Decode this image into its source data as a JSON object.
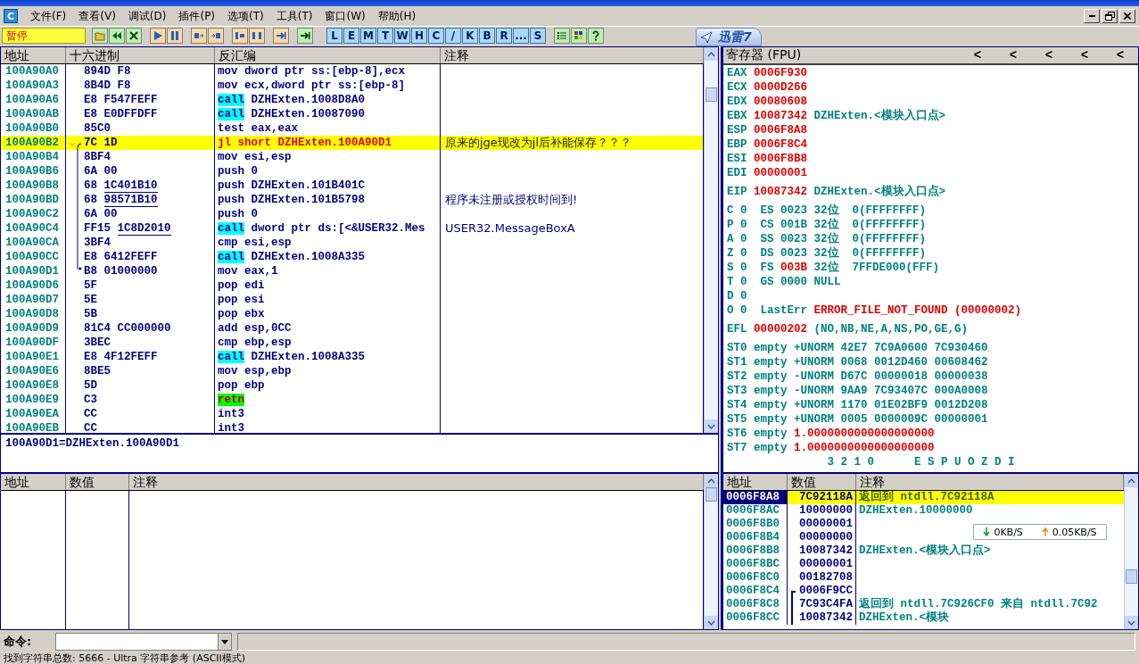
{
  "app_icon": "C",
  "menu": [
    "文件(F)",
    "查看(V)",
    "调试(D)",
    "插件(P)",
    "选项(T)",
    "工具(T)",
    "窗口(W)",
    "帮助(H)"
  ],
  "toolbar": {
    "status": "暂停",
    "letter_buttons": [
      "L",
      "E",
      "M",
      "T",
      "W",
      "H",
      "C",
      "/",
      "K",
      "B",
      "R",
      "...",
      "S"
    ]
  },
  "disassembly": {
    "columns": [
      "地址",
      "十六进制",
      "反汇编",
      "注释"
    ],
    "rows": [
      {
        "address": "100A90A0",
        "hex": "894D F8",
        "disasm": "mov dword ptr ss:[ebp-8],ecx",
        "kind": "plain",
        "selected": false
      },
      {
        "address": "100A90A3",
        "hex": "8B4D F8",
        "disasm": "mov ecx,dword ptr ss:[ebp-8]",
        "kind": "plain",
        "selected": false
      },
      {
        "address": "100A90A6",
        "hex": "E8 F547FEFF",
        "mnemonic": "call",
        "disasm": "DZHExten.1008D8A0",
        "kind": "call",
        "selected": false
      },
      {
        "address": "100A90AB",
        "hex": "E8 E0DFFDFF",
        "mnemonic": "call",
        "disasm": "DZHExten.10087090",
        "kind": "call",
        "selected": false
      },
      {
        "address": "100A90B0",
        "hex": "85C0",
        "disasm": "test eax,eax",
        "kind": "plain",
        "selected": false
      },
      {
        "address": "100A90B2",
        "hex": "7C 1D",
        "disasm": "jl short DZHExten.100A90D1",
        "kind": "jump",
        "selected": true,
        "jump_source": true,
        "comment": "原来的jge现改为jl后补能保存？？？"
      },
      {
        "address": "100A90B4",
        "hex": "8BF4",
        "disasm": "mov esi,esp",
        "kind": "plain",
        "selected": false
      },
      {
        "address": "100A90B6",
        "hex": "6A 00",
        "disasm": "push 0",
        "kind": "plain",
        "selected": false
      },
      {
        "address": "100A90B8",
        "hex": "68",
        "hex_fixup": "1C401B10",
        "disasm": "push DZHExten.101B401C",
        "kind": "plain",
        "selected": false
      },
      {
        "address": "100A90BD",
        "hex": "68",
        "hex_fixup": "98571B10",
        "disasm": "push DZHExten.101B5798",
        "kind": "plain",
        "selected": false,
        "comment": "程序未注册或授权时间到!"
      },
      {
        "address": "100A90C2",
        "hex": "6A 00",
        "disasm": "push 0",
        "kind": "plain",
        "selected": false
      },
      {
        "address": "100A90C4",
        "hex": "FF15",
        "hex_fixup": "1C8D2010",
        "mnemonic": "call",
        "disasm": "dword ptr ds:[<&USER32.Mes",
        "kind": "call",
        "selected": false,
        "comment": "USER32.MessageBoxA"
      },
      {
        "address": "100A90CA",
        "hex": "3BF4",
        "disasm": "cmp esi,esp",
        "kind": "plain",
        "selected": false
      },
      {
        "address": "100A90CC",
        "hex": "E8 6412FEFF",
        "mnemonic": "call",
        "disasm": "DZHExten.1008A335",
        "kind": "call",
        "selected": false
      },
      {
        "address": "100A90D1",
        "hex": "B8 01000000",
        "disasm": "mov eax,1",
        "kind": "plain",
        "selected": false,
        "jump_target": true
      },
      {
        "address": "100A90D6",
        "hex": "5F",
        "disasm": "pop edi",
        "kind": "plain",
        "selected": false
      },
      {
        "address": "100A90D7",
        "hex": "5E",
        "disasm": "pop esi",
        "kind": "plain",
        "selected": false
      },
      {
        "address": "100A90D8",
        "hex": "5B",
        "disasm": "pop ebx",
        "kind": "plain",
        "selected": false
      },
      {
        "address": "100A90D9",
        "hex": "81C4 CC000000",
        "disasm": "add esp,0CC",
        "kind": "plain",
        "selected": false
      },
      {
        "address": "100A90DF",
        "hex": "3BEC",
        "disasm": "cmp ebp,esp",
        "kind": "plain",
        "selected": false
      },
      {
        "address": "100A90E1",
        "hex": "E8 4F12FEFF",
        "mnemonic": "call",
        "disasm": "DZHExten.1008A335",
        "kind": "call",
        "selected": false
      },
      {
        "address": "100A90E6",
        "hex": "8BE5",
        "disasm": "mov esp,ebp",
        "kind": "plain",
        "selected": false
      },
      {
        "address": "100A90E8",
        "hex": "5D",
        "disasm": "pop ebp",
        "kind": "plain",
        "selected": false
      },
      {
        "address": "100A90E9",
        "hex": "C3",
        "mnemonic": "retn",
        "kind": "ret",
        "selected": false
      },
      {
        "address": "100A90EA",
        "hex": "CC",
        "disasm": "int3",
        "kind": "plain",
        "selected": false
      },
      {
        "address": "100A90EB",
        "hex": "CC",
        "disasm": "int3",
        "kind": "plain",
        "selected": false
      }
    ],
    "info": "100A90D1=DZHExten.100A90D1"
  },
  "registers": {
    "title": "寄存器 (FPU)",
    "arrows": [
      "<",
      "<",
      "<",
      "<",
      "<"
    ],
    "groups": [
      [
        [
          {
            "text": "EAX "
          },
          {
            "text": "0006F930",
            "changed": true
          }
        ],
        [
          {
            "text": "ECX "
          },
          {
            "text": "0000D266",
            "changed": true
          }
        ],
        [
          {
            "text": "EDX "
          },
          {
            "text": "00080608",
            "changed": true
          }
        ],
        [
          {
            "text": "EBX "
          },
          {
            "text": "10087342",
            "changed": true
          },
          {
            "text": " DZHExten.<模块入口点>"
          }
        ],
        [
          {
            "text": "ESP "
          },
          {
            "text": "0006F8A8",
            "changed": true
          }
        ],
        [
          {
            "text": "EBP "
          },
          {
            "text": "0006F8C4",
            "changed": true
          }
        ],
        [
          {
            "text": "ESI "
          },
          {
            "text": "0006F8B8",
            "changed": true
          }
        ],
        [
          {
            "text": "EDI "
          },
          {
            "text": "00000001",
            "changed": true
          }
        ]
      ],
      [
        [
          {
            "text": "EIP "
          },
          {
            "text": "10087342",
            "changed": true
          },
          {
            "text": " DZHExten.<模块入口点>"
          }
        ]
      ],
      [
        [
          {
            "text": "C 0  ES 0023 32位  0(FFFFFFFF)"
          }
        ],
        [
          {
            "text": "P 0  CS 001B 32位  0(FFFFFFFF)"
          }
        ],
        [
          {
            "text": "A 0  SS 0023 32位  0(FFFFFFFF)"
          }
        ],
        [
          {
            "text": "Z 0  DS 0023 32位  0(FFFFFFFF)"
          }
        ],
        [
          {
            "text": "S 0  FS "
          },
          {
            "text": "003B",
            "changed": true
          },
          {
            "text": " 32位  7FFDE000(FFF)"
          }
        ],
        [
          {
            "text": "T 0  GS 0000 NULL"
          }
        ],
        [
          {
            "text": "D 0"
          }
        ],
        [
          {
            "text": "O 0  LastErr "
          },
          {
            "text": "ERROR_FILE_NOT_FOUND (00000002)",
            "changed": true
          }
        ]
      ],
      [
        [
          {
            "text": "EFL "
          },
          {
            "text": "00000202",
            "changed": true
          },
          {
            "text": " (NO,NB,NE,A,NS,PO,GE,G)"
          }
        ]
      ],
      [
        [
          {
            "text": "ST0 empty +UNORM 42E7 7C9A0600 7C930460"
          }
        ],
        [
          {
            "text": "ST1 empty +UNORM 0068 0012D460 00608462"
          }
        ],
        [
          {
            "text": "ST2 empty -UNORM D67C 00000018 00000038"
          }
        ],
        [
          {
            "text": "ST3 empty -UNORM 9AA9 7C93407C 000A0008"
          }
        ],
        [
          {
            "text": "ST4 empty +UNORM 1170 01E02BF9 0012D208"
          }
        ],
        [
          {
            "text": "ST5 empty +UNORM 0005 0000009C 00000001"
          }
        ],
        [
          {
            "text": "ST6 empty "
          },
          {
            "text": "1.0000000000000000000",
            "changed": true
          }
        ],
        [
          {
            "text": "ST7 empty "
          },
          {
            "text": "1.0000000000000000000",
            "changed": true
          }
        ],
        [
          {
            "text": "               3 2 1 0      E S P U O Z D I"
          }
        ]
      ]
    ]
  },
  "dump": {
    "columns": [
      "地址",
      "数值",
      "注释"
    ]
  },
  "stack": {
    "columns": [
      "地址",
      "数值",
      "注释"
    ],
    "rows": [
      {
        "address": "0006F8A8",
        "value": "7C92118A",
        "comment": "返回到 ntdll.7C92118A",
        "selected": true
      },
      {
        "address": "0006F8AC",
        "value": "10000000",
        "comment": "DZHExten.10000000",
        "selected": false
      },
      {
        "address": "0006F8B0",
        "value": "00000001",
        "selected": false
      },
      {
        "address": "0006F8B4",
        "value": "00000000",
        "selected": false
      },
      {
        "address": "0006F8B8",
        "value": "10087342",
        "comment": "DZHExten.<模块入口点>",
        "selected": false
      },
      {
        "address": "0006F8BC",
        "value": "00000001",
        "selected": false
      },
      {
        "address": "0006F8C0",
        "value": "00182708",
        "selected": false
      },
      {
        "address": "0006F8C4",
        "value": "0006F9CC",
        "selected": false,
        "bracket_start": true
      },
      {
        "address": "0006F8C8",
        "value": "7C93C4FA",
        "comment": "返回到 ntdll.7C926CF0 来自 ntdll.7C92",
        "selected": false,
        "in_bracket": true
      },
      {
        "address": "0006F8CC",
        "value": "10087342",
        "comment": "DZHExten.<模块",
        "selected": false,
        "in_bracket": true
      }
    ]
  },
  "thunder": {
    "tab": "迅雷7",
    "download": "0KB/S",
    "upload": "0.05KB/S"
  },
  "command": {
    "label": "命令:"
  },
  "status_bar": "找到字符串总数: 5666 - Ultra 字符串参考 (ASCII模式)"
}
